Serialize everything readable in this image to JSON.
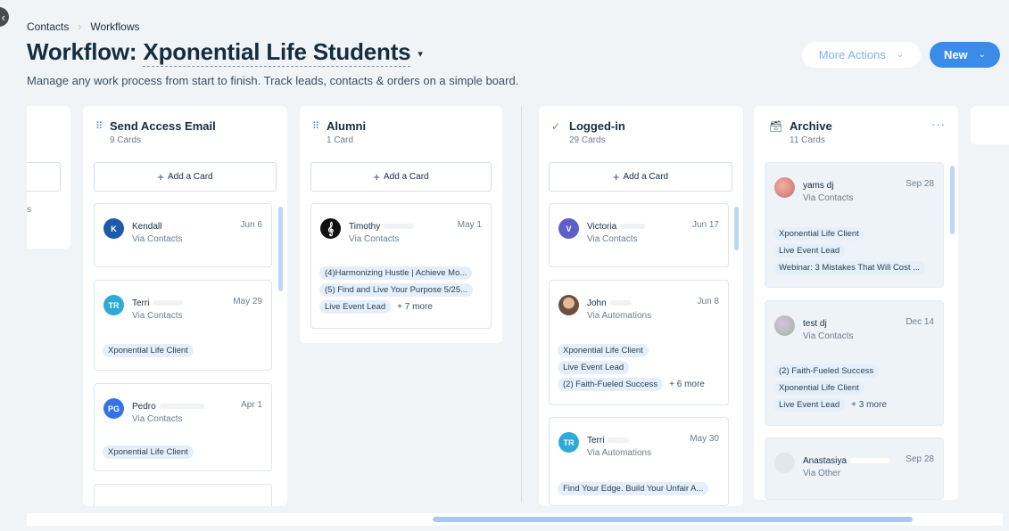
{
  "breadcrumb": {
    "items": [
      "Contacts",
      "Workflows"
    ]
  },
  "header": {
    "title_prefix": "Workflow:",
    "title_name": "Xponential Life Students",
    "subtitle": "Manage any work process from start to finish. Track leads, contacts & orders on a simple board."
  },
  "actions": {
    "more_actions": "More Actions",
    "new": "New"
  },
  "columns": {
    "partial": {
      "tail_text": "s"
    },
    "send_access": {
      "title": "Send Access Email",
      "count": "9 Cards",
      "add": "Add a Card",
      "cards": [
        {
          "initials": "K",
          "name": "Kendall",
          "via": "Via Contacts",
          "date": "Jun 6",
          "color": "#1f5aa8"
        },
        {
          "initials": "TR",
          "name": "Terri",
          "via": "Via Contacts",
          "date": "May 29",
          "color": "#2fa9d8",
          "tags": [
            "Xponential Life Client"
          ]
        },
        {
          "initials": "PG",
          "name": "Pedro",
          "via": "Via Contacts",
          "date": "Apr 1",
          "color": "#3473e6",
          "tags": [
            "Xponential Life Client"
          ]
        }
      ]
    },
    "alumni": {
      "title": "Alumni",
      "count": "1 Card",
      "add": "Add a Card",
      "cards": [
        {
          "name": "Timothy",
          "via": "Via Contacts",
          "date": "May 1",
          "tags": [
            "(4)Harmonizing Hustle | Achieve Mo...",
            "(5) Find and Live Your Purpose 5/25...",
            "Live Event Lead"
          ],
          "more": "+ 7 more"
        }
      ]
    },
    "logged_in": {
      "title": "Logged-in",
      "count": "29 Cards",
      "add": "Add a Card",
      "cards": [
        {
          "initials": "V",
          "name": "Victoria",
          "via": "Via Contacts",
          "date": "Jun 17",
          "color": "#5b5fc7"
        },
        {
          "name": "John",
          "via": "Via Automations",
          "date": "Jun 8",
          "tags": [
            "Xponential Life Client",
            "Live Event Lead",
            "(2) Faith-Fueled Success"
          ],
          "more": "+ 6 more"
        },
        {
          "initials": "TR",
          "name": "Terri",
          "via": "Via Automations",
          "date": "May 30",
          "color": "#2fa9d8",
          "tags": [
            "Find Your Edge. Build Your Unfair A..."
          ]
        }
      ]
    },
    "archive": {
      "title": "Archive",
      "count": "11 Cards",
      "cards": [
        {
          "name": "yams dj",
          "via": "Via Contacts",
          "date": "Sep 28",
          "tags": [
            "Xponential Life Client",
            "Live Event Lead",
            "Webinar: 3 Mistakes That Will Cost ..."
          ]
        },
        {
          "name": "test dj",
          "via": "Via Contacts",
          "date": "Dec 14",
          "tags": [
            "(2) Faith-Fueled Success",
            "Xponential Life Client",
            "Live Event Lead"
          ],
          "more": "+ 3 more"
        },
        {
          "name": "Anastasiya",
          "via": "Via Other",
          "date": "Sep 28"
        }
      ]
    }
  }
}
